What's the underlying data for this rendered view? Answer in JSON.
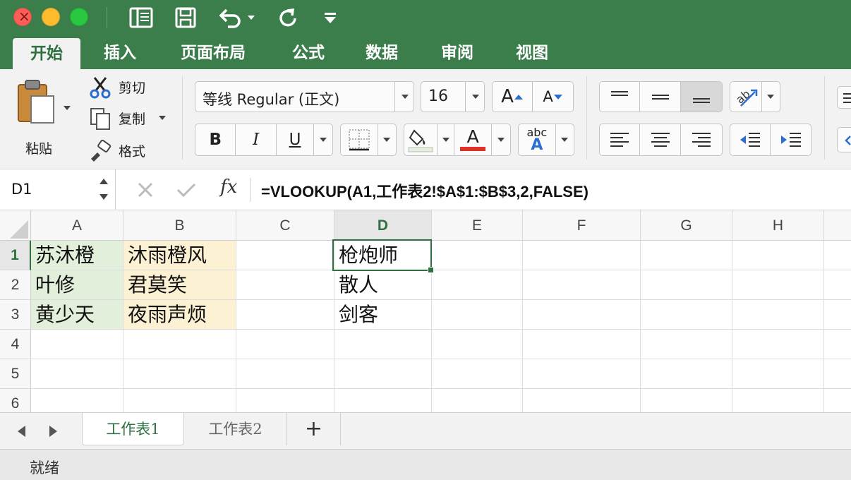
{
  "colors": {
    "accent": "#3c7d4c",
    "selection": "#2e7040",
    "fill_green": "#e2efdb",
    "fill_yellow": "#fdf1d4",
    "font_red": "#e0302a"
  },
  "icons": [
    "close-icon",
    "minimize-icon",
    "zoom-icon",
    "sidebar-toggle-icon",
    "save-icon",
    "undo-icon",
    "redo-icon",
    "customize-icon",
    "paste-icon",
    "cut-icon",
    "copy-icon",
    "format-painter-icon",
    "fill-color-icon",
    "font-color-icon",
    "fx-icon"
  ],
  "ribbon_tabs": [
    "开始",
    "插入",
    "页面布局",
    "公式",
    "数据",
    "审阅",
    "视图"
  ],
  "clipboard": {
    "paste": "粘贴",
    "cut": "剪切",
    "copy": "复制",
    "format": "格式"
  },
  "font": {
    "family": "等线 Regular (正文)",
    "size": "16",
    "bold": "B",
    "italic": "I",
    "underline": "U",
    "grow": "A",
    "shrink": "A",
    "font_color_glyph": "A",
    "spell": "abc",
    "spell_a": "A"
  },
  "formula_bar": {
    "name_box": "D1",
    "fx": "fx",
    "formula": "=VLOOKUP(A1,工作表2!$A$1:$B$3,2,FALSE)"
  },
  "grid": {
    "columns": [
      "A",
      "B",
      "C",
      "D",
      "E",
      "F",
      "G",
      "H"
    ],
    "rows": [
      "1",
      "2",
      "3",
      "4",
      "5",
      "6"
    ],
    "cells": {
      "A1": "苏沐橙",
      "B1": "沐雨橙风",
      "D1": "枪炮师",
      "A2": "叶修",
      "B2": "君莫笑",
      "D2": "散人",
      "A3": "黄少天",
      "B3": "夜雨声烦",
      "D3": "剑客"
    },
    "selected": "D1"
  },
  "sheets": {
    "tab1": "工作表1",
    "tab2": "工作表2",
    "add": "+"
  },
  "status": "就绪"
}
